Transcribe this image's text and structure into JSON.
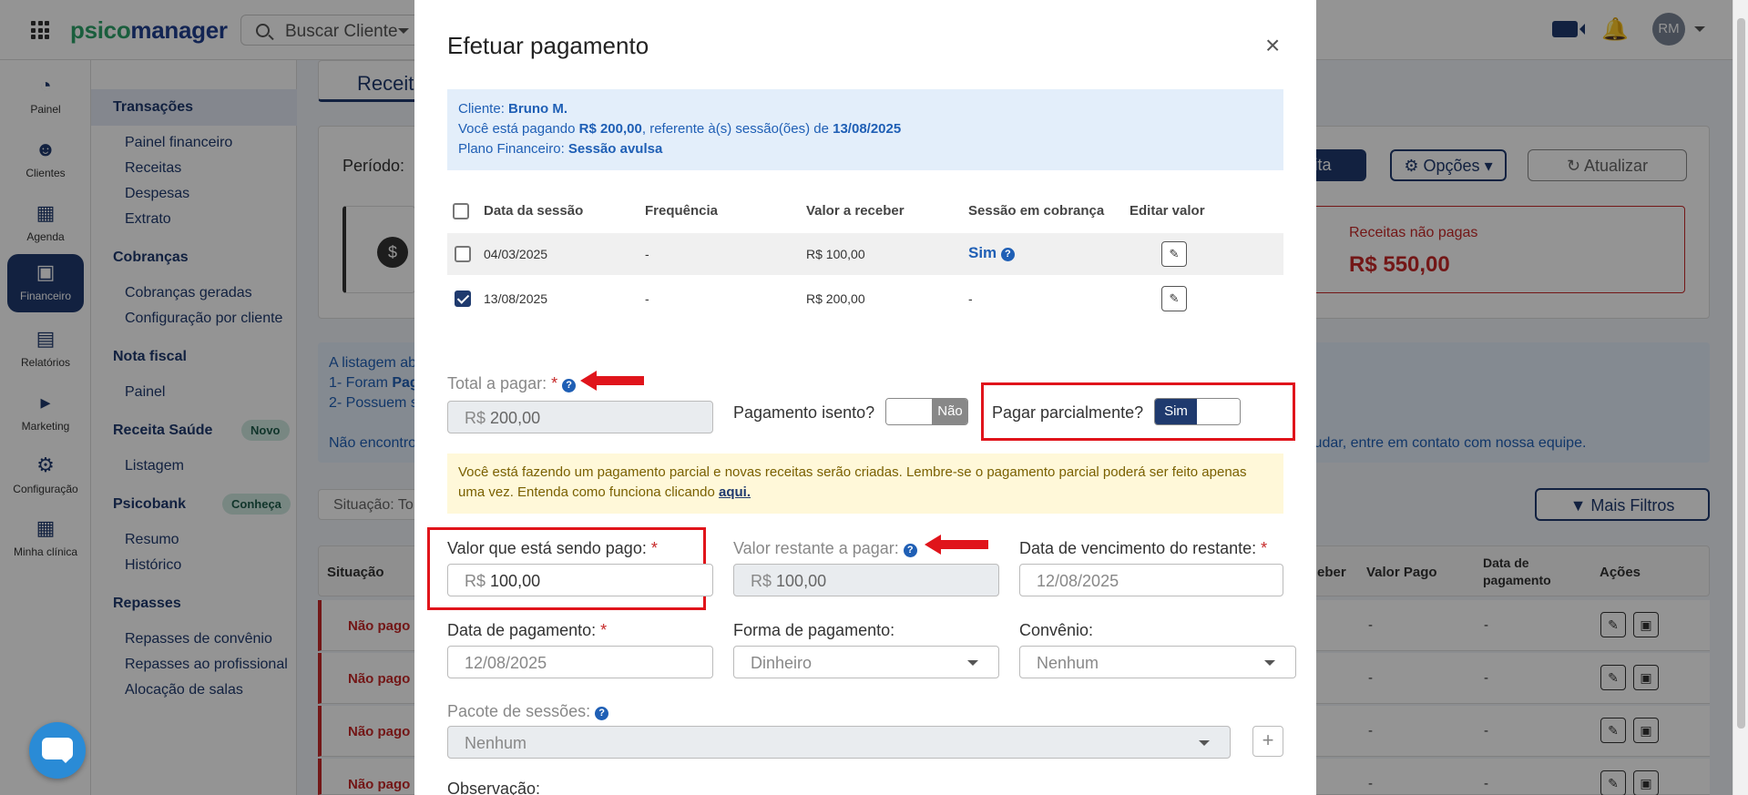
{
  "app": {
    "logo_part1": "psico",
    "logo_part2": "manager",
    "search_placeholder": "Buscar Cliente",
    "avatar_initials": "RM"
  },
  "sidebar": {
    "items": [
      {
        "label": "Painel",
        "icon": "dashboard-icon"
      },
      {
        "label": "Clientes",
        "icon": "users-icon"
      },
      {
        "label": "Agenda",
        "icon": "calendar-icon"
      },
      {
        "label": "Financeiro",
        "icon": "money-icon",
        "active": true
      },
      {
        "label": "Relatórios",
        "icon": "report-icon"
      },
      {
        "label": "Marketing",
        "icon": "megaphone-icon"
      },
      {
        "label": "Configuração",
        "icon": "gear-icon"
      },
      {
        "label": "Minha clínica",
        "icon": "building-icon"
      }
    ]
  },
  "subnav": {
    "transacoes": "Transações",
    "painel_financeiro": "Painel financeiro",
    "receitas": "Receitas",
    "despesas": "Despesas",
    "extrato": "Extrato",
    "cobrancas": "Cobranças",
    "cobrancas_geradas": "Cobranças geradas",
    "config_cliente": "Configuração por cliente",
    "nota_fiscal": "Nota fiscal",
    "nf_painel": "Painel",
    "receita_saude": "Receita Saúde",
    "novo_badge": "Novo",
    "listagem": "Listagem",
    "psicobank": "Psicobank",
    "conheca_badge": "Conheça",
    "resumo": "Resumo",
    "historico": "Histórico",
    "repasses": "Repasses",
    "repasses_convenio": "Repasses de convênio",
    "repasses_profissional": "Repasses ao profissional",
    "alocacao_salas": "Alocação de salas"
  },
  "main": {
    "tab_receitas": "Receit",
    "periodo_label": "Período:",
    "btn_nova_partial": "ita",
    "btn_opcoes": "Opções",
    "btn_atualizar": "Atualizar",
    "nao_pagas_label": "Receitas não pagas",
    "nao_pagas_value": "R$ 550,00",
    "info_line1": "A listagem ab",
    "info_line2_a": "1- Foram ",
    "info_line2_b": "Pag",
    "info_line3": "2- Possuem s",
    "info_line4": "Não encontro",
    "info_line4_right": "judar, entre em contato com nossa equipe.",
    "situacao_filter": "Situação: To",
    "mais_filtros": "Mais Filtros",
    "col_situacao": "Situação",
    "col_receber": "eber",
    "col_valor_pago": "Valor Pago",
    "col_data_pag_1": "Data de",
    "col_data_pag_2": "pagamento",
    "col_acoes": "Ações",
    "rows": [
      {
        "status": "Não pago",
        "valor_pago": "-",
        "data": "-"
      },
      {
        "status": "Não pago",
        "valor_pago": "-",
        "data": "-"
      },
      {
        "status": "Não pago",
        "valor_pago": "-",
        "data": "-"
      },
      {
        "status": "Não pago",
        "valor_pago": "-",
        "data": "-"
      }
    ]
  },
  "modal": {
    "title": "Efetuar pagamento",
    "close": "×",
    "info": {
      "cliente_label": "Cliente: ",
      "cliente": "Bruno M.",
      "pagando_pre": "Você está pagando ",
      "pagando_valor": "R$ 200,00",
      "pagando_mid": ", referente à(s) sessão(ões) de ",
      "pagando_data": "13/08/2025",
      "plano_label": "Plano Financeiro: ",
      "plano": "Sessão avulsa"
    },
    "table": {
      "headers": [
        "Data da sessão",
        "Frequência",
        "Valor a receber",
        "Sessão em cobrança",
        "Editar valor"
      ],
      "rows": [
        {
          "data": "04/03/2025",
          "freq": "-",
          "valor": "R$ 100,00",
          "cobranca": "Sim",
          "checked": false
        },
        {
          "data": "13/08/2025",
          "freq": "-",
          "valor": "R$ 200,00",
          "cobranca": "-",
          "checked": true
        }
      ]
    },
    "total_label": "Total a pagar:",
    "total_prefix": "R$",
    "total_value": "200,00",
    "isento_label": "Pagamento isento?",
    "isento_value": "Não",
    "parcial_label": "Pagar parcialmente?",
    "parcial_value": "Sim",
    "warning_text": "Você está fazendo um pagamento parcial e novas receitas serão criadas. Lembre-se o pagamento parcial poderá ser feito apenas uma vez. Entenda como funciona clicando ",
    "warning_link": "aqui.",
    "valor_pago_label": "Valor que está sendo pago:",
    "valor_pago_prefix": "R$",
    "valor_pago_value": "100,00",
    "restante_label": "Valor restante a pagar:",
    "restante_prefix": "R$",
    "restante_value": "100,00",
    "venc_label": "Data de vencimento do restante:",
    "venc_value": "12/08/2025",
    "data_pag_label": "Data de pagamento:",
    "data_pag_value": "12/08/2025",
    "forma_label": "Forma de pagamento:",
    "forma_value": "Dinheiro",
    "convenio_label": "Convênio:",
    "convenio_value": "Nenhum",
    "pacote_label": "Pacote de sessões:",
    "pacote_value": "Nenhum",
    "obs_label": "Observação:",
    "required_mark": "*",
    "help_mark": "?"
  },
  "colors": {
    "primary": "#1f3a6e",
    "accent_red": "#c62828",
    "highlight_box": "#e0141b",
    "info_blue": "#1f5fb5"
  }
}
